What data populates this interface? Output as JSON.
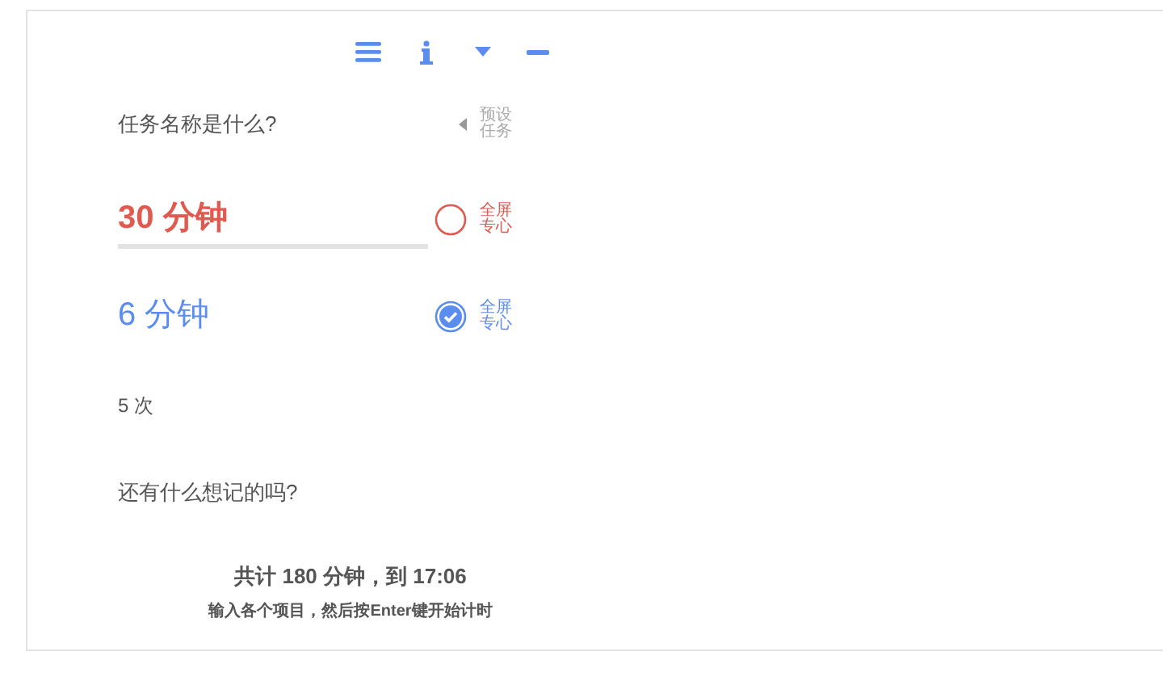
{
  "task_name": {
    "placeholder": "任务名称是什么?"
  },
  "preset_button": {
    "label": "预设任务"
  },
  "timers": [
    {
      "kind": "work",
      "value": "30 分钟",
      "focused": true,
      "fullscreen": {
        "label": "全屏专心",
        "checked": false
      }
    },
    {
      "kind": "break",
      "value": "6 分钟",
      "focused": false,
      "fullscreen": {
        "label": "全屏专心",
        "checked": true
      }
    }
  ],
  "repeat": {
    "value": "5 次"
  },
  "notes": {
    "placeholder": "还有什么想记的吗?"
  },
  "summary": {
    "total": "共计 180 分钟，到 17:06",
    "hint": "输入各个项目，然后按Enter键开始计时"
  }
}
